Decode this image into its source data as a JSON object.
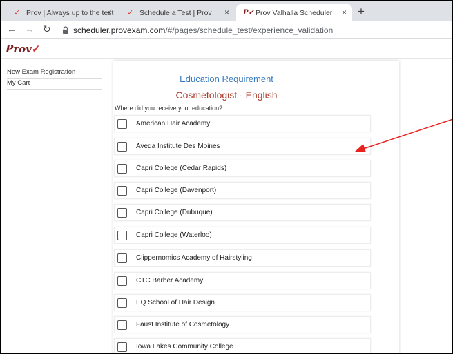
{
  "browser": {
    "tabs": [
      {
        "title": "Prov | Always up to the test",
        "active": false
      },
      {
        "title": "Schedule a Test | Prov",
        "active": false
      },
      {
        "title": "Prov Valhalla Scheduler",
        "active": true
      }
    ],
    "new_tab": "+",
    "close_glyph": "×",
    "url_host": "scheduler.provexam.com",
    "url_path": "/#/pages/schedule_test/experience_validation"
  },
  "site": {
    "logo_text": "Prov",
    "logo_mark": "✓"
  },
  "sidebar": {
    "items": [
      {
        "label": "New Exam Registration"
      },
      {
        "label": "My Cart"
      }
    ]
  },
  "main": {
    "heading": "Education Requirement",
    "subheading": "Cosmetologist - English",
    "question": "Where did you receive your education?",
    "options": [
      {
        "label": "American Hair Academy",
        "checked": false
      },
      {
        "label": "Aveda Institute Des Moines",
        "checked": false
      },
      {
        "label": "Capri College (Cedar Rapids)",
        "checked": false
      },
      {
        "label": "Capri College (Davenport)",
        "checked": false
      },
      {
        "label": "Capri College (Dubuque)",
        "checked": false
      },
      {
        "label": "Capri College (Waterloo)",
        "checked": false
      },
      {
        "label": "Clippernomics Academy of Hairstyling",
        "checked": false
      },
      {
        "label": "CTC Barber Academy",
        "checked": false
      },
      {
        "label": "EQ School of Hair Design",
        "checked": false
      },
      {
        "label": "Faust Institute of Cosmetology",
        "checked": false
      },
      {
        "label": "Iowa Lakes Community College",
        "checked": false
      }
    ]
  },
  "colors": {
    "heading": "#3b7bbf",
    "subheading": "#a93a2a",
    "annotation_arrow": "#e8231e"
  }
}
